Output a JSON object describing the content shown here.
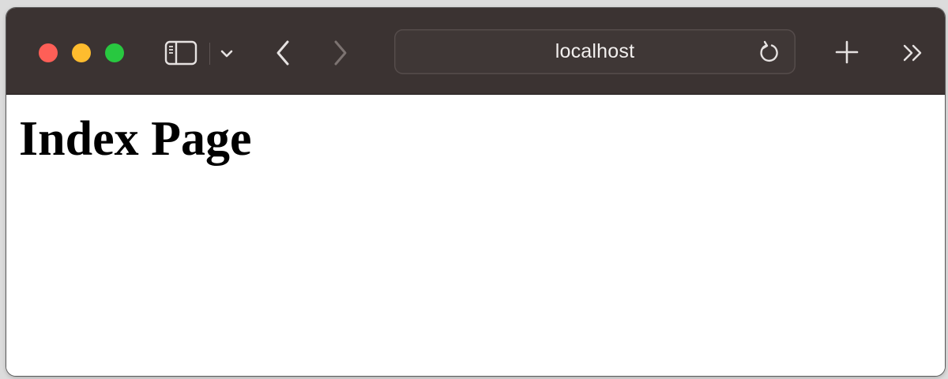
{
  "browser": {
    "address_bar": {
      "url_text": "localhost"
    },
    "colors": {
      "toolbar_background": "#3b3332",
      "close_button": "#fe5f57",
      "minimize_button": "#febc2e",
      "maximize_button": "#28c840"
    },
    "icons": {
      "sidebar": "sidebar-toggle-icon",
      "tab_menu": "chevron-down-icon",
      "back": "chevron-left-icon",
      "forward": "chevron-right-icon",
      "reload": "reload-icon",
      "new_tab": "plus-icon",
      "overflow": "double-chevron-right-icon"
    }
  },
  "page": {
    "heading": "Index Page"
  }
}
